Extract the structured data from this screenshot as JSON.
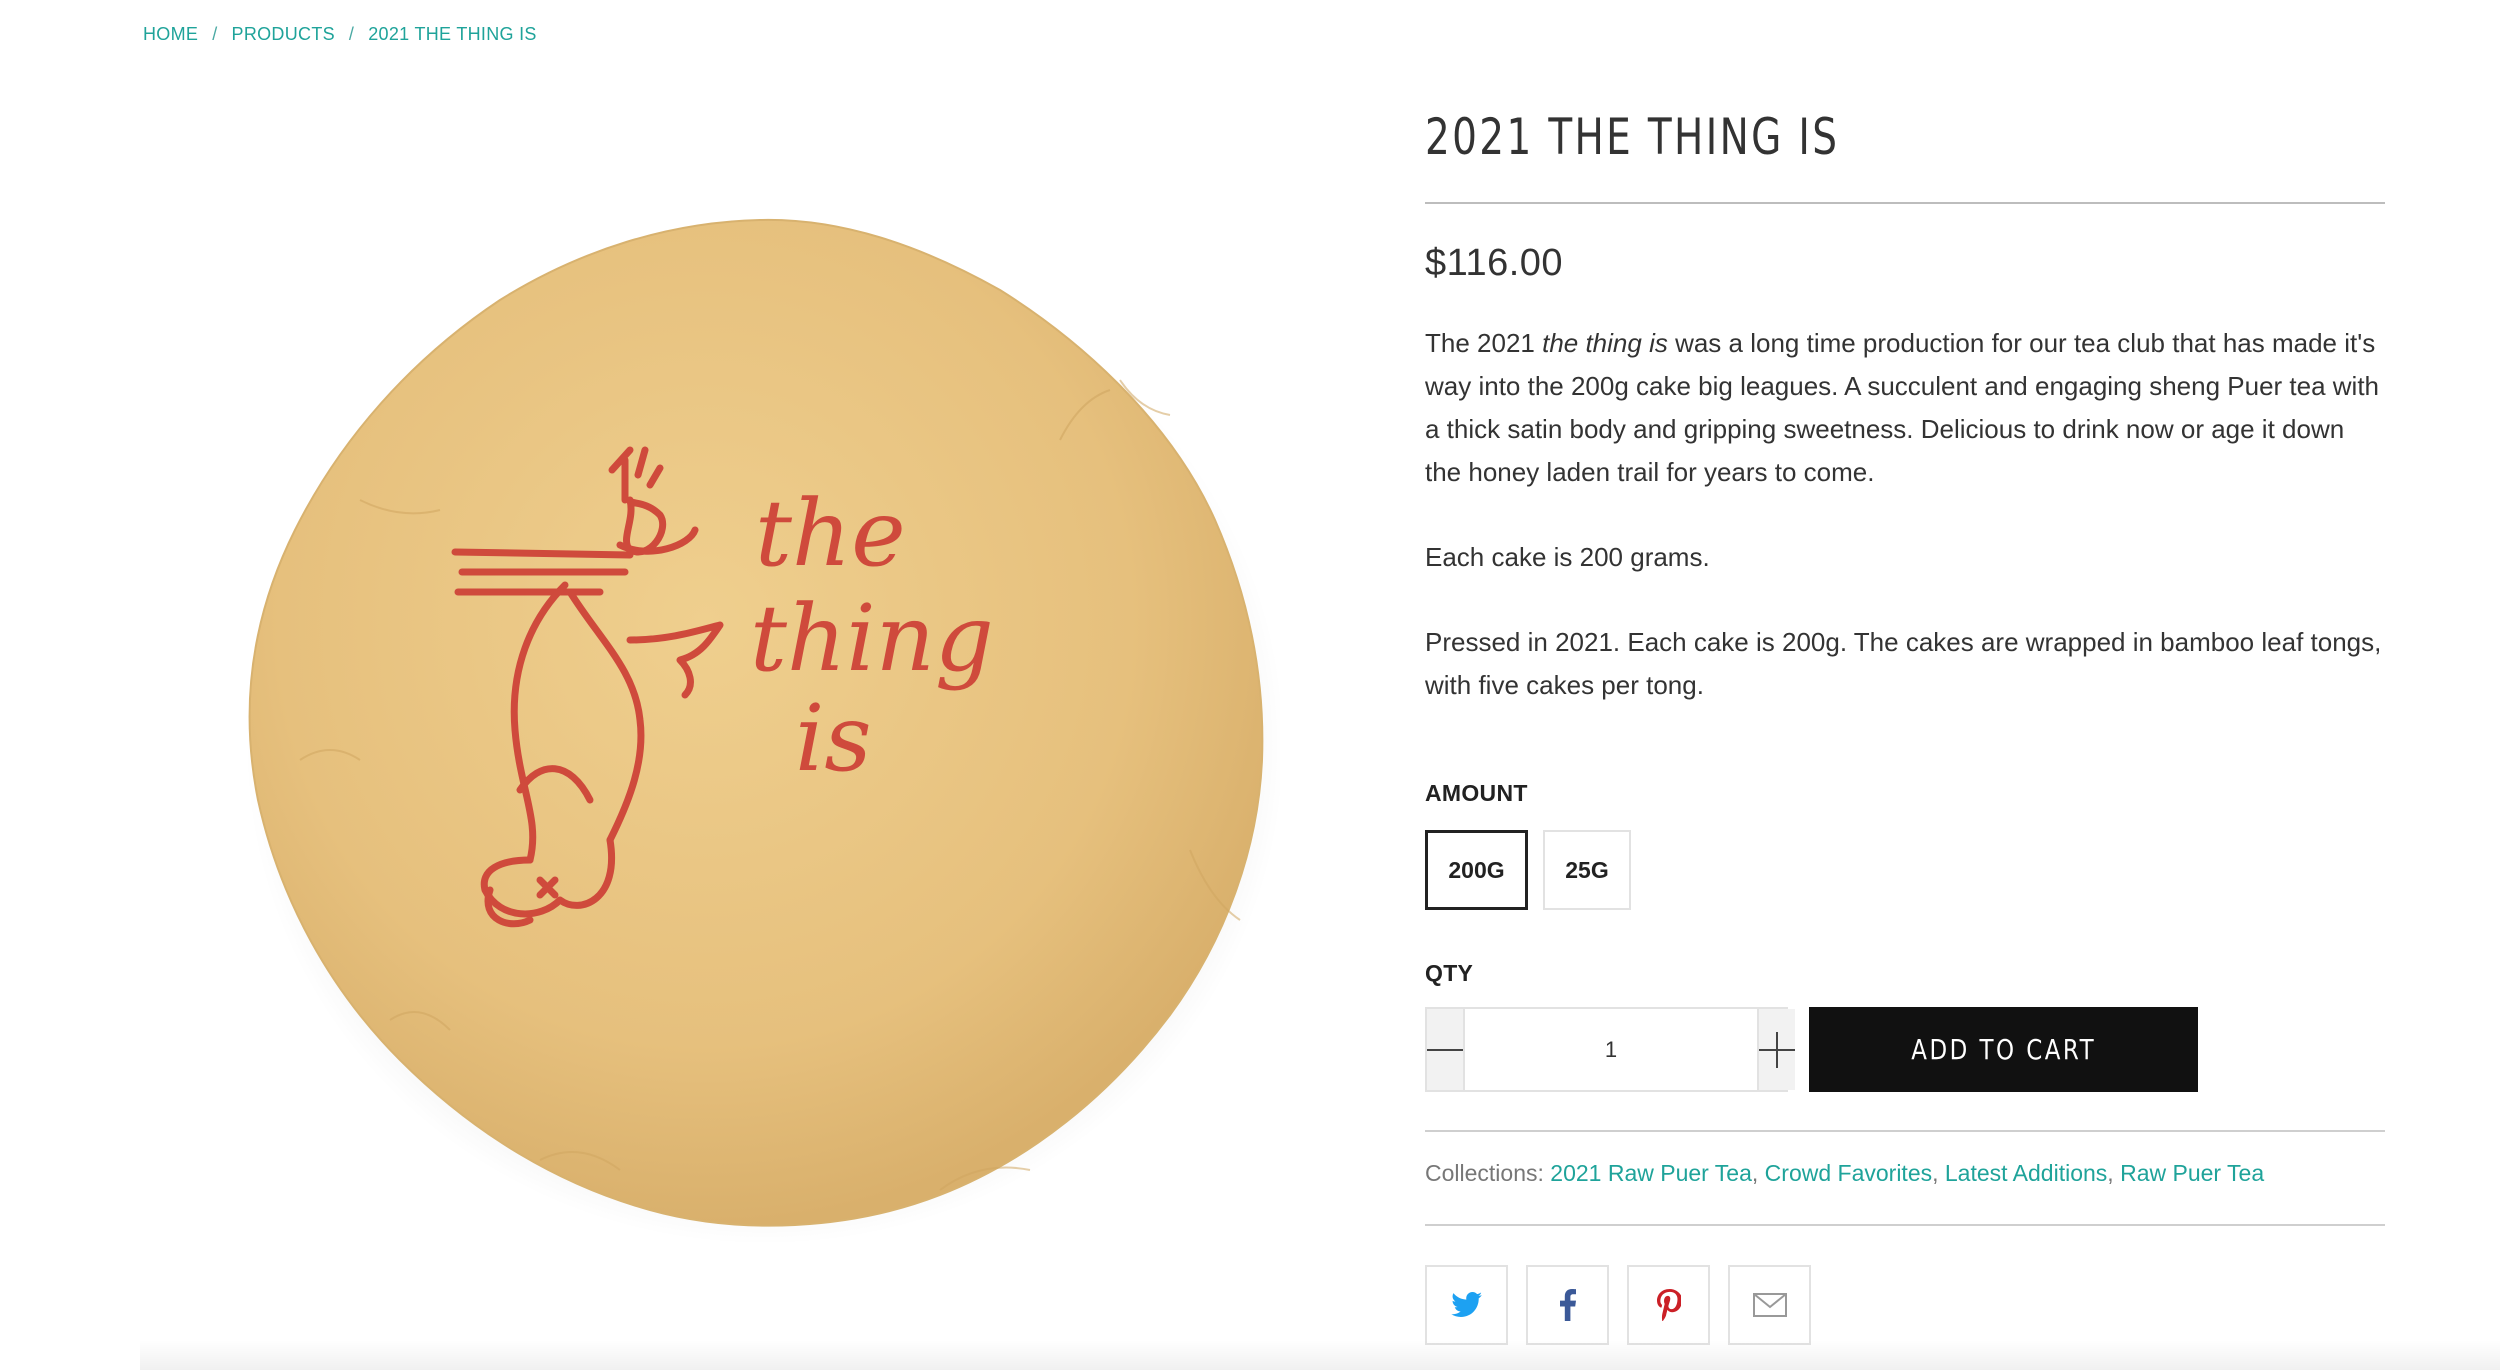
{
  "breadcrumb": {
    "home": "HOME",
    "products": "PRODUCTS",
    "current": "2021 THE THING IS",
    "separator": "/"
  },
  "product": {
    "image_text_line1": "the",
    "image_text_line2": "thing",
    "image_text_line3": "is",
    "title": "2021 THE THING IS",
    "price": "$116.00",
    "description": {
      "p1_before": "The 2021 ",
      "p1_italic": "the thing is",
      "p1_after": " was a long time production for our tea club that has made it's way into the 200g cake big leagues. A succulent and engaging sheng Puer tea with a thick satin body and gripping sweetness. Delicious to drink now or age it down the honey laden trail for years to come.",
      "p2": "Each cake is 200 grams.",
      "p3": "Pressed in 2021. Each cake is 200g. The cakes are wrapped in bamboo leaf tongs, with five cakes per tong."
    },
    "amount_label": "AMOUNT",
    "amount_options": [
      "200G",
      "25G"
    ],
    "amount_selected": "200G",
    "qty_label": "QTY",
    "qty_value": "1",
    "add_to_cart": "ADD TO CART",
    "collections_label": "Collections:",
    "collections": [
      "2021 Raw Puer Tea",
      "Crowd Favorites",
      "Latest Additions",
      "Raw Puer Tea"
    ],
    "collection_separator": ","
  },
  "share": {
    "icons": [
      "twitter-icon",
      "facebook-icon",
      "pinterest-icon",
      "email-icon"
    ]
  },
  "colors": {
    "accent": "#1fa39a",
    "button_bg": "#111111",
    "wrapper": "#e8c27f",
    "stamp_red": "#cf4a3c",
    "twitter": "#1da1f2",
    "facebook": "#3b5998",
    "pinterest": "#cb2027"
  }
}
